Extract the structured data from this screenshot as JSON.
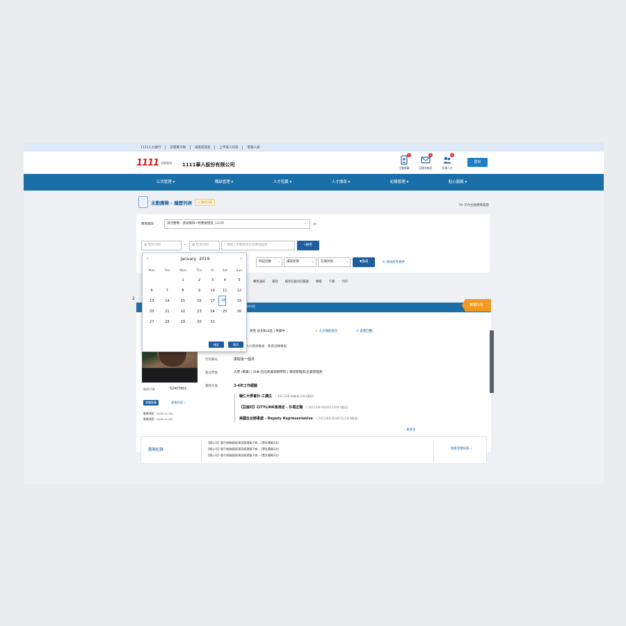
{
  "topbar": [
    "1111人力銀行",
    "記帳電子報",
    "滿意度調查",
    "上半案人訊息",
    "客服人員"
  ],
  "header": {
    "logo_mark": "1111",
    "logo_sub1": "招募管理",
    "logo_sub2": "",
    "company": "1111華人股份有限公司",
    "icons": [
      {
        "label": "主動推薦",
        "badge": "2",
        "icon": "document-icon"
      },
      {
        "label": "回應系統訊",
        "badge": "1",
        "icon": "mail-icon"
      },
      {
        "label": "找尋人才",
        "badge": "3",
        "icon": "people-icon"
      }
    ],
    "logout": "登出"
  },
  "nav": [
    "公司管理 ▾",
    "職缺管理 ▾",
    "人才招募 ▾",
    "人才搜尋 ▾",
    "紀錄管理 ▾",
    "貼心服務 ▾"
  ],
  "page": {
    "title": "主動應徵 - 履歷列表",
    "tag": "◎ 操作示範",
    "right_note": "90 天內主動應徵履歷"
  },
  "filters": {
    "job_label": "應徵職缺",
    "job_value": "請勿應徵 - 測試職缺+製應徵開發_12/26",
    "date_start": "開始日期",
    "date_end": "結束日期",
    "keyword_placeholder": "請輸入求職者姓名或應徵編號",
    "search_btn": "搜尋",
    "dd1": "時段回應",
    "dd2": "讀取狀態",
    "dd3": "在職狀態",
    "filter_btn": "篩選",
    "clear_link": "清除所有條件"
  },
  "toolbar": [
    "轉寄通知",
    "刪除",
    "刪除已刪同的履歷",
    "轉發",
    "下載",
    "列印"
  ],
  "calendar": {
    "month": "January",
    "year": "2019",
    "weekdays": [
      "Mon",
      "Tue",
      "Wed",
      "Thu",
      "Fri",
      "Sat",
      "Sun"
    ],
    "weeks": [
      [
        "",
        "",
        "1",
        "2",
        "3",
        "4",
        "5"
      ],
      [
        "6",
        "7",
        "8",
        "9",
        "10",
        "11",
        "12"
      ],
      [
        "13",
        "14",
        "15",
        "16",
        "17",
        "18",
        "19"
      ],
      [
        "20",
        "21",
        "22",
        "23",
        "24",
        "25",
        "26"
      ],
      [
        "27",
        "28",
        "29",
        "30",
        "31",
        "",
        ""
      ]
    ],
    "selected_day": "18",
    "btn1": "確定",
    "btn2": "取消"
  },
  "card": {
    "head_left": "2",
    "head_time": "19:00",
    "ribbon": "剩餘3天",
    "personal": "男性  台北松山區  | 待業中",
    "star_link": "九大職能報告",
    "mail_link": "查看回覆",
    "job_cats": "行銷企劃部 - 產品企劃主管 - 人力資源專員 - 教育訓練專員",
    "avail_label": "可到職日",
    "avail_value": "率取後一個月",
    "edu_label": "最高學歷",
    "edu_value": "大學 (畢業)  |  日本-台北商業技術學院  |  資訊管理系/企業管理系",
    "exp_label": "實務年資",
    "exp_value": "3-4年工作經驗",
    "experiences": [
      {
        "title": "輔仁大學會計-工讀生",
        "date": "( 2011/06-8/無年(2年3個月)"
      },
      {
        "title": "【豆腐村】CITYLINK南港店 - 外場正職",
        "date": "( 2011/08-2020/11(2年3個月)"
      },
      {
        "title": "美國在台辦事處 - Deputy Representative",
        "date": "( 2011/08-2020/11(2年3個月)"
      }
    ],
    "more_link": "...看更多",
    "id_label": "應徵代碼",
    "id_value": "52407601",
    "chip": "將職推薦",
    "view_record": "查看紀錄 »",
    "date1": "應徵時間：2019-12-26 |",
    "date2": "應徵時間：2019-12-26 |"
  },
  "records": {
    "title": "應徵紀錄",
    "lines": [
      "【總公司】電子商務經理/資深經理電子商... (累計應徵2次)",
      "【總公司】電子商務經理/資深經理電子商... (累計應徵2次)",
      "【總公司】電子商務經理/資深經理電子商... (累計應徵2次)"
    ],
    "more": "查看完整紀錄 »"
  }
}
